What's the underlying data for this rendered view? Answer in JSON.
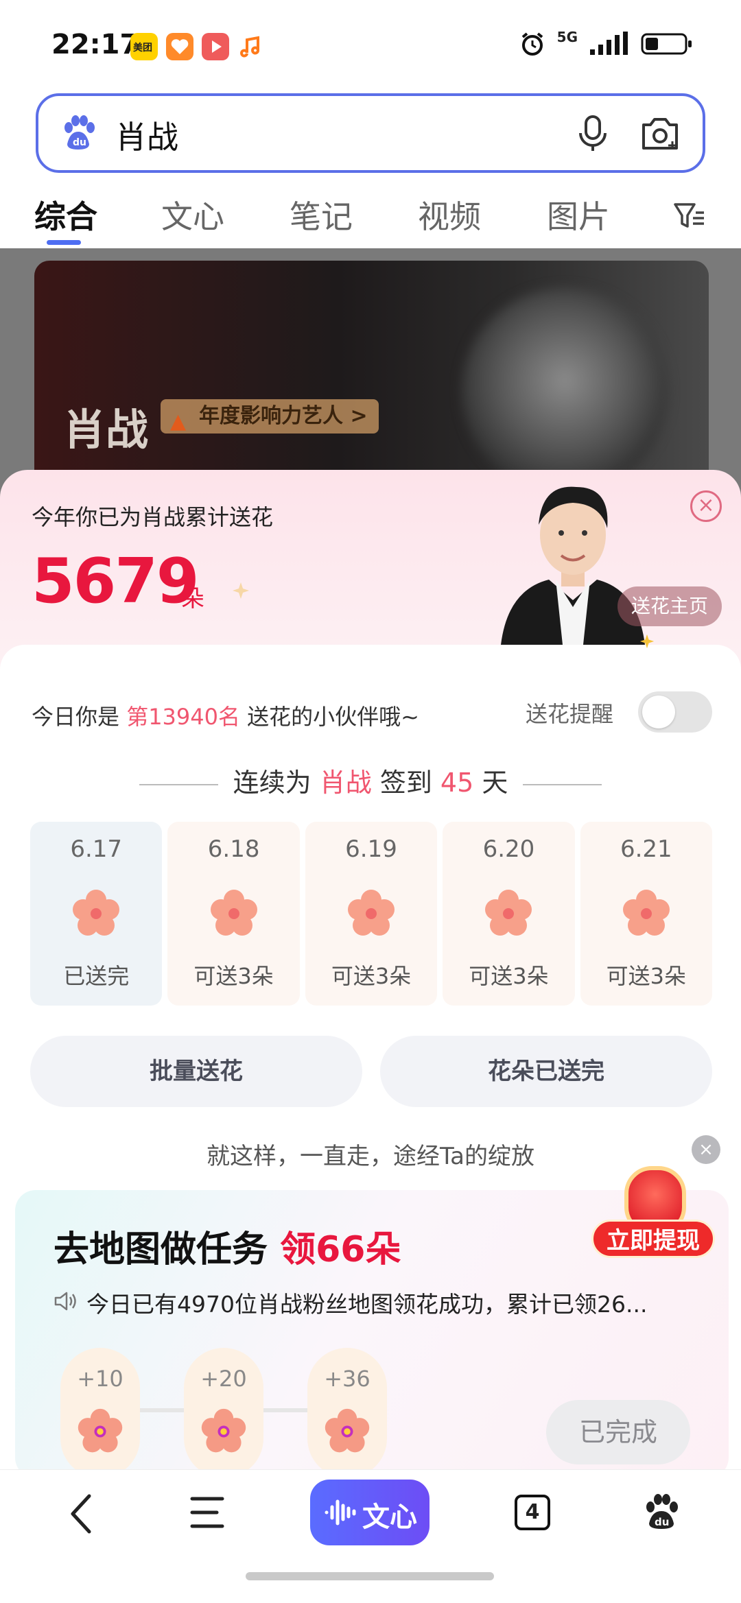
{
  "status_bar": {
    "time": "22:17",
    "network": "5G",
    "app_icons": [
      {
        "name": "meituan-icon",
        "label": "美团",
        "color": "#ffd100"
      },
      {
        "name": "heart-app-icon",
        "color": "#ff8a2a"
      },
      {
        "name": "video-app-icon",
        "color": "#ef5b5b"
      },
      {
        "name": "music-app-icon",
        "color": "#ff7a1a"
      }
    ]
  },
  "search": {
    "query": "肖战"
  },
  "tabs": [
    {
      "label": "综合",
      "active": true
    },
    {
      "label": "文心",
      "active": false
    },
    {
      "label": "笔记",
      "active": false
    },
    {
      "label": "视频",
      "active": false
    },
    {
      "label": "图片",
      "active": false
    }
  ],
  "background_card": {
    "name": "肖战",
    "tag": "年度影响力艺人 >"
  },
  "sheet": {
    "header_title": "今年你已为肖战累计送花",
    "flower_count": "5679",
    "flower_unit": "朵",
    "home_button": "送花主页",
    "rank_prefix": "今日你是 ",
    "rank_value": "第13940名",
    "rank_suffix": " 送花的小伙伴哦~",
    "reminder_label": "送花提醒",
    "reminder_on": false,
    "streak_prefix": "连续为 ",
    "streak_name": "肖战",
    "streak_mid": " 签到 ",
    "streak_days": "45",
    "streak_suffix": " 天",
    "days": [
      {
        "date": "6.17",
        "status": "已送完",
        "done": true
      },
      {
        "date": "6.18",
        "status": "可送3朵",
        "done": false
      },
      {
        "date": "6.19",
        "status": "可送3朵",
        "done": false
      },
      {
        "date": "6.20",
        "status": "可送3朵",
        "done": false
      },
      {
        "date": "6.21",
        "status": "可送3朵",
        "done": false
      }
    ],
    "batch_button": "批量送花",
    "sent_out_button": "花朵已送完",
    "tip_text": "就这样，一直走，途经Ta的绽放",
    "task": {
      "title": "去地图做任务 ",
      "title_highlight": "领66朵",
      "news": "今日已有4970位肖战粉丝地图领花成功，累计已领26...",
      "rewards": [
        "+10",
        "+20",
        "+36"
      ],
      "done_button": "已完成"
    },
    "cashout_label": "立即提现"
  },
  "bottom_nav": {
    "wenxin_label": "文心",
    "tab_count": "4"
  },
  "colors": {
    "accent_blue": "#4e6ef2",
    "flower_red": "#e8173e",
    "highlight_pink": "#f0566f"
  }
}
